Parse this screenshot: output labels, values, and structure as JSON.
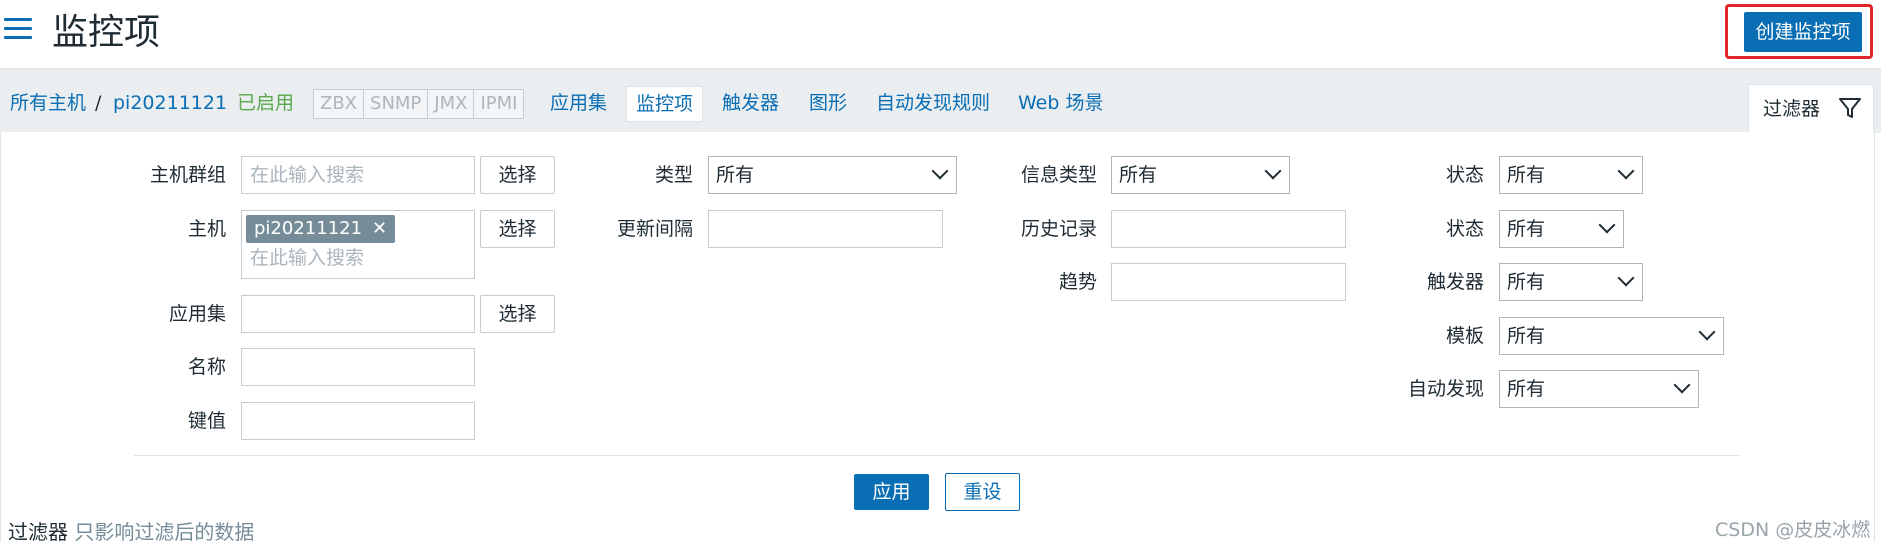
{
  "header": {
    "title": "监控项",
    "create_button": "创建监控项",
    "menu_icon": "hamburger-menu-icon"
  },
  "breadcrumb": {
    "all_hosts": "所有主机",
    "separator": "/",
    "host": "pi20211121",
    "status": "已启用",
    "tags": [
      "ZBX",
      "SNMP",
      "JMX",
      "IPMI"
    ]
  },
  "tabs": [
    "应用集",
    "监控项",
    "触发器",
    "图形",
    "自动发现规则",
    "Web 场景"
  ],
  "active_tab": "监控项",
  "filter_tab": {
    "label": "过滤器",
    "icon": "funnel-icon"
  },
  "filter": {
    "host_group": {
      "label": "主机群组",
      "placeholder": "在此输入搜索",
      "button": "选择"
    },
    "host": {
      "label": "主机",
      "chip": "pi20211121",
      "placeholder": "在此输入搜索",
      "button": "选择"
    },
    "application": {
      "label": "应用集",
      "value": "",
      "button": "选择"
    },
    "name": {
      "label": "名称",
      "value": ""
    },
    "key": {
      "label": "键值",
      "value": ""
    },
    "type": {
      "label": "类型",
      "value": "所有"
    },
    "update_interval": {
      "label": "更新间隔",
      "value": ""
    },
    "info_type": {
      "label": "信息类型",
      "value": "所有"
    },
    "history": {
      "label": "历史记录",
      "value": ""
    },
    "trends": {
      "label": "趋势",
      "value": ""
    },
    "state": {
      "label": "状态",
      "value": "所有"
    },
    "status": {
      "label": "状态",
      "value": "所有"
    },
    "triggers": {
      "label": "触发器",
      "value": "所有"
    },
    "template": {
      "label": "模板",
      "value": "所有"
    },
    "discovery": {
      "label": "自动发现",
      "value": "所有"
    },
    "apply_button": "应用",
    "reset_button": "重设"
  },
  "footer": {
    "filter_label": "过滤器",
    "filter_note": "只影响过滤后的数据",
    "watermark": "CSDN @皮皮冰燃"
  },
  "colors": {
    "primary": "#0a6eb4",
    "enabled": "#59a84b",
    "highlight": "#e0262b",
    "chip": "#768d99"
  }
}
